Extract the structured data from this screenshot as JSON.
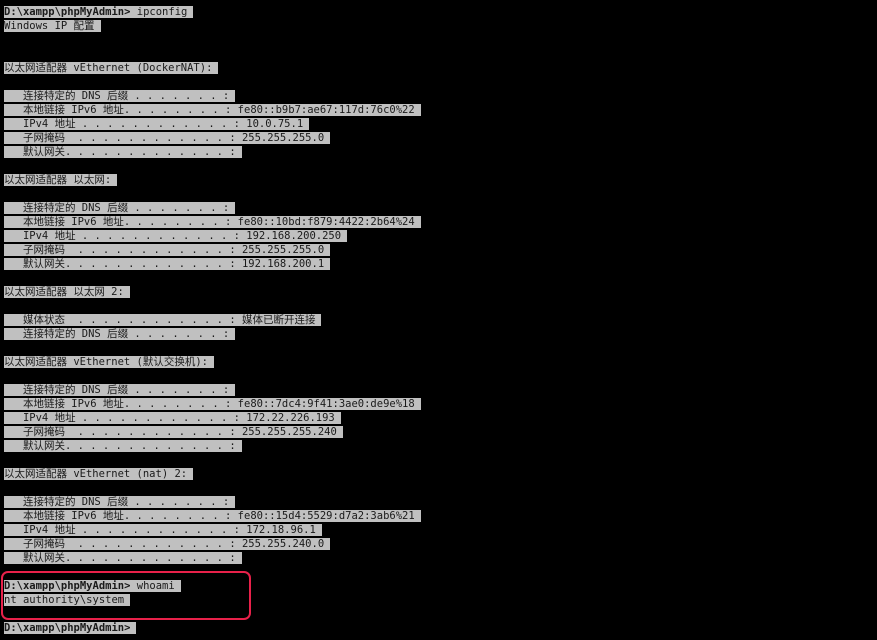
{
  "lines": [
    {
      "kind": "prompt",
      "path": "D:\\xampp\\phpMyAdmin>",
      "cmd": " ipconfig"
    },
    {
      "kind": "text",
      "text": "Windows IP 配置"
    },
    {
      "kind": "text",
      "text": "以太网适配器 vEthernet (DockerNAT):"
    },
    {
      "kind": "text",
      "text": "   连接特定的 DNS 后缀 . . . . . . . :"
    },
    {
      "kind": "text",
      "text": "   本地链接 IPv6 地址. . . . . . . . : fe80::b9b7:ae67:117d:76c0%22"
    },
    {
      "kind": "text",
      "text": "   IPv4 地址 . . . . . . . . . . . . : 10.0.75.1"
    },
    {
      "kind": "text",
      "text": "   子网掩码  . . . . . . . . . . . . : 255.255.255.0"
    },
    {
      "kind": "text",
      "text": "   默认网关. . . . . . . . . . . . . :"
    },
    {
      "kind": "text",
      "text": "以太网适配器 以太网:"
    },
    {
      "kind": "text",
      "text": "   连接特定的 DNS 后缀 . . . . . . . :"
    },
    {
      "kind": "text",
      "text": "   本地链接 IPv6 地址. . . . . . . . : fe80::10bd:f879:4422:2b64%24"
    },
    {
      "kind": "text",
      "text": "   IPv4 地址 . . . . . . . . . . . . : 192.168.200.250"
    },
    {
      "kind": "text",
      "text": "   子网掩码  . . . . . . . . . . . . : 255.255.255.0"
    },
    {
      "kind": "text",
      "text": "   默认网关. . . . . . . . . . . . . : 192.168.200.1"
    },
    {
      "kind": "text",
      "text": "以太网适配器 以太网 2:"
    },
    {
      "kind": "text",
      "text": "   媒体状态  . . . . . . . . . . . . : 媒体已断开连接"
    },
    {
      "kind": "text",
      "text": "   连接特定的 DNS 后缀 . . . . . . . :"
    },
    {
      "kind": "text",
      "text": "以太网适配器 vEthernet (默认交换机):"
    },
    {
      "kind": "text",
      "text": "   连接特定的 DNS 后缀 . . . . . . . :"
    },
    {
      "kind": "text",
      "text": "   本地链接 IPv6 地址. . . . . . . . : fe80::7dc4:9f41:3ae0:de9e%18"
    },
    {
      "kind": "text",
      "text": "   IPv4 地址 . . . . . . . . . . . . : 172.22.226.193"
    },
    {
      "kind": "text",
      "text": "   子网掩码  . . . . . . . . . . . . : 255.255.255.240"
    },
    {
      "kind": "text",
      "text": "   默认网关. . . . . . . . . . . . . :"
    },
    {
      "kind": "text",
      "text": "以太网适配器 vEthernet (nat) 2:"
    },
    {
      "kind": "text",
      "text": "   连接特定的 DNS 后缀 . . . . . . . :"
    },
    {
      "kind": "text",
      "text": "   本地链接 IPv6 地址. . . . . . . . : fe80::15d4:5529:d7a2:3ab6%21"
    },
    {
      "kind": "text",
      "text": "   IPv4 地址 . . . . . . . . . . . . : 172.18.96.1"
    },
    {
      "kind": "text",
      "text": "   子网掩码  . . . . . . . . . . . . : 255.255.240.0"
    },
    {
      "kind": "text",
      "text": "   默认网关. . . . . . . . . . . . . :"
    },
    {
      "kind": "prompt",
      "path": "D:\\xampp\\phpMyAdmin>",
      "cmd": " whoami"
    },
    {
      "kind": "text",
      "text": "nt authority\\system"
    },
    {
      "kind": "prompt",
      "path": "D:\\xampp\\phpMyAdmin>",
      "cmd": ""
    }
  ],
  "colors": {
    "background": "#000000",
    "text_highlight": "#c0c0c0",
    "text": "#1a1a1a",
    "annotation_box": "#e8214a"
  }
}
